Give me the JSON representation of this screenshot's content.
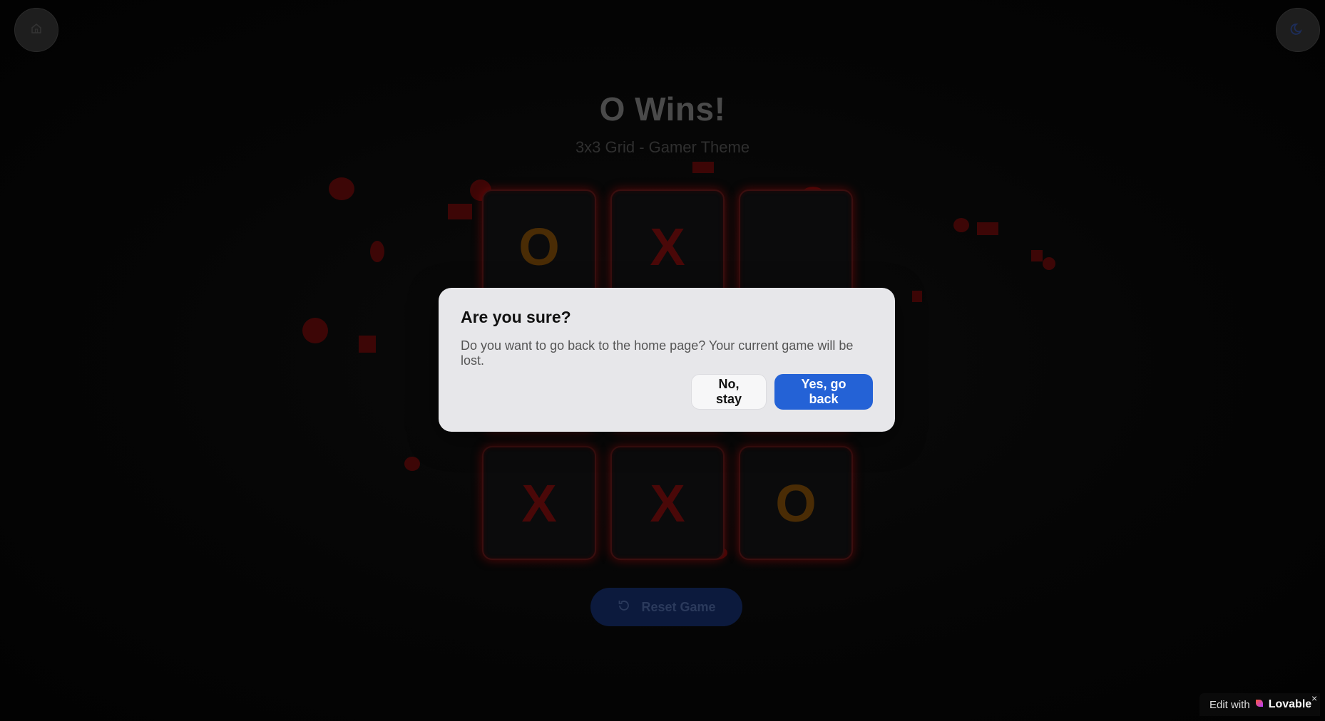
{
  "header": {
    "title": "O Wins!",
    "subtitle": "3x3 Grid - Gamer Theme"
  },
  "board": {
    "cells": [
      "O",
      "X",
      "",
      "",
      "",
      "",
      "X",
      "X",
      "O"
    ]
  },
  "controls": {
    "reset_label": "Reset Game"
  },
  "dialog": {
    "title": "Are you sure?",
    "description": "Do you want to go back to the home page? Your current game will be lost.",
    "cancel_label": "No, stay",
    "confirm_label": "Yes, go back"
  },
  "badge": {
    "prefix": "Edit with",
    "brand": "Lovable",
    "close": "×"
  },
  "colors": {
    "x_mark": "#4a0808",
    "o_mark": "#4a2c05",
    "confirm_button": "#2462d6",
    "dialog_bg": "#e7e7ea"
  },
  "icons": {
    "home": "home-icon",
    "theme": "moon-icon",
    "reset": "refresh-icon"
  }
}
